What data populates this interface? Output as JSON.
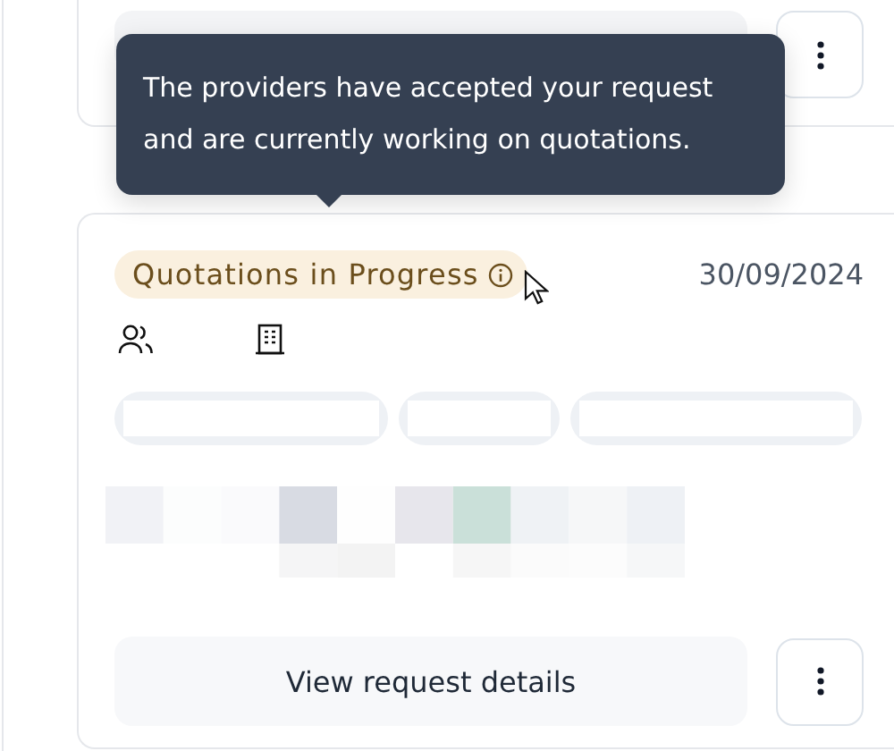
{
  "tooltip": {
    "text": "The providers have accepted your request and are currently working on quotations."
  },
  "request": {
    "status": "Quotations in Progress",
    "date": "30/09/2024",
    "action": "View request details"
  }
}
